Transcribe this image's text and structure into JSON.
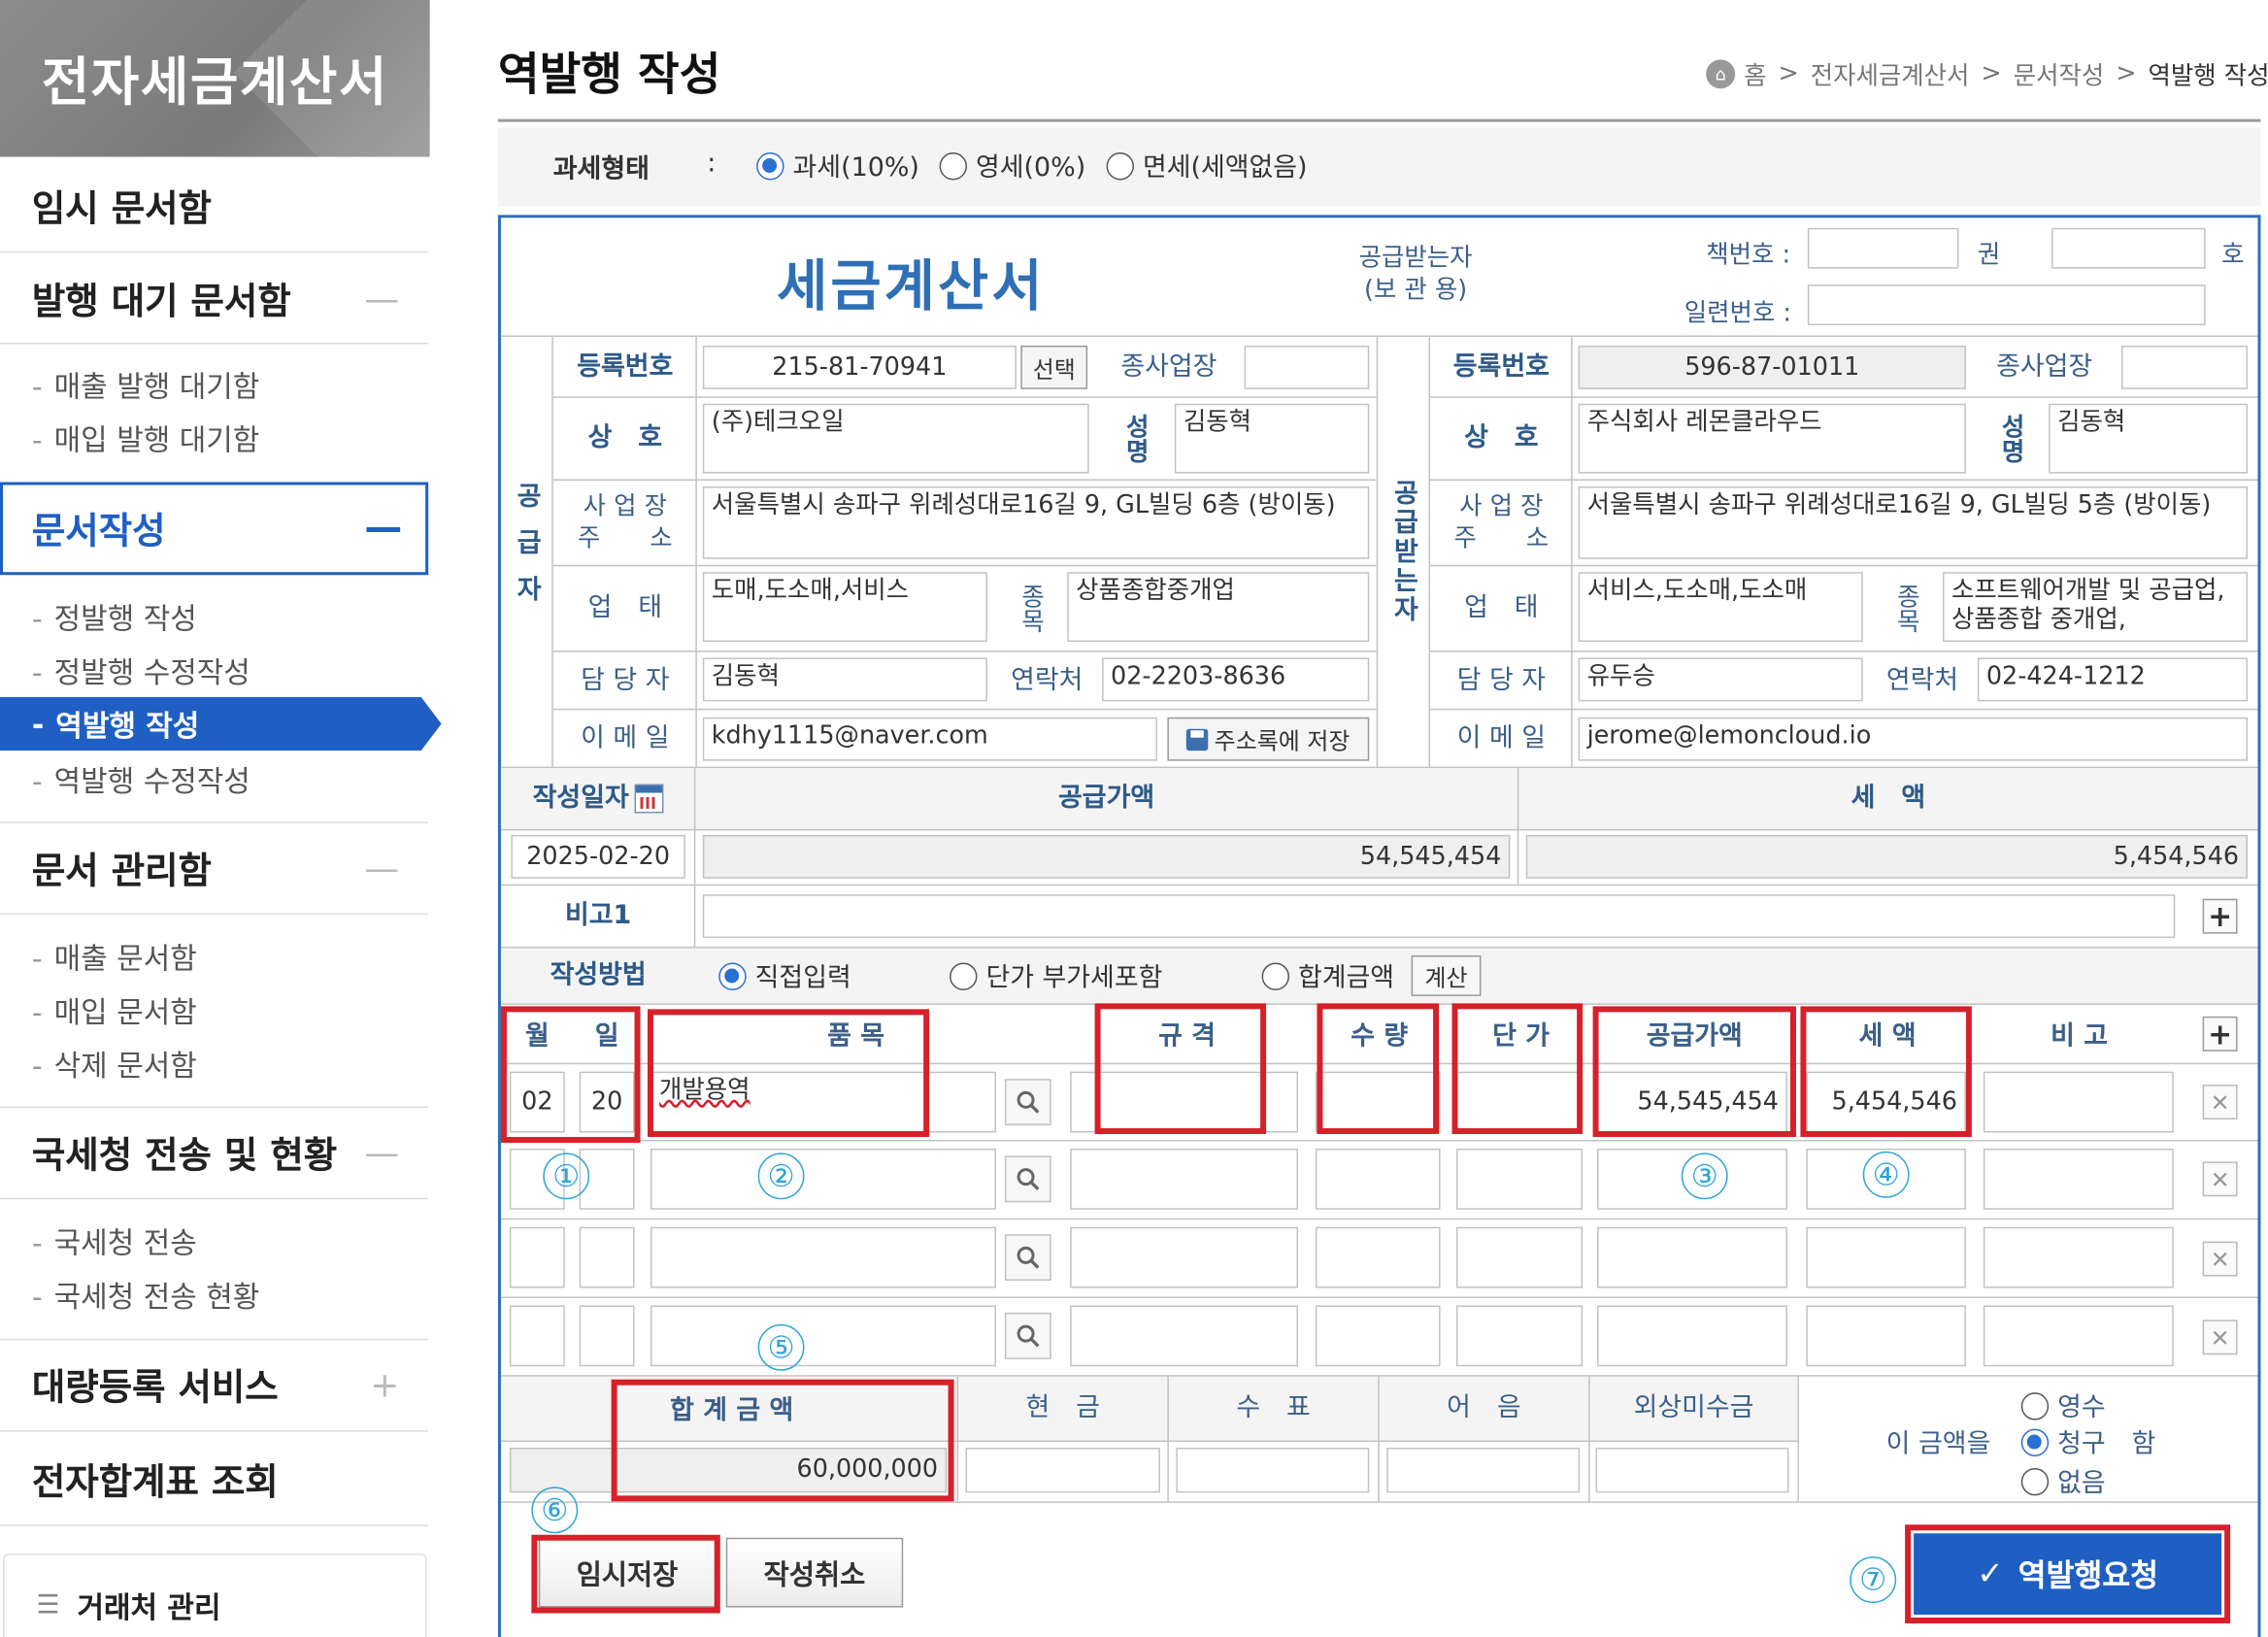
{
  "sidebar": {
    "title": "전자세금계산서",
    "sections": [
      {
        "label": "임시 문서함"
      },
      {
        "label": "발행 대기 문서함",
        "toggle": "—",
        "items": [
          "매출 발행 대기함",
          "매입 발행 대기함"
        ]
      },
      {
        "label": "문서작성",
        "toggle": "—",
        "items": [
          "정발행 작성",
          "정발행 수정작성",
          "역발행 작성",
          "역발행 수정작성"
        ],
        "active_item": "역발행 작성"
      },
      {
        "label": "문서 관리함",
        "toggle": "—",
        "items": [
          "매출 문서함",
          "매입 문서함",
          "삭제 문서함"
        ]
      },
      {
        "label": "국세청 전송 및 현황",
        "toggle": "—",
        "items": [
          "국세청 전송",
          "국세청 전송 현황"
        ]
      },
      {
        "label": "대량등록 서비스",
        "toggle": "+"
      },
      {
        "label": "전자합계표 조회"
      }
    ],
    "bottom_label": "거래처 관리"
  },
  "page": {
    "title": "역발행 작성",
    "breadcrumb": [
      "홈",
      "전자세금계산서",
      "문서작성",
      "역발행 작성"
    ]
  },
  "tax_type": {
    "label": "과세형태",
    "colon": ":",
    "options": [
      "과세(10%)",
      "영세(0%)",
      "면세(세액없음)"
    ],
    "selected": "과세(10%)"
  },
  "invoice": {
    "title": "세금계산서",
    "recipient_note": "공급받는자",
    "recipient_note2": "(보 관 용)",
    "book_no_label": "책번호 :",
    "book_kwon": "권",
    "book_ho": "호",
    "serial_label": "일련번호 :"
  },
  "supplier": {
    "side_label": "공급자",
    "reg_no_label": "등록번호",
    "reg_no": "215-81-70941",
    "select_button": "선택",
    "branch_label": "종사업장",
    "name_label": "상　호",
    "name": "(주)테크오일",
    "rep_label": "성명",
    "rep": "김동혁",
    "addr_label": "사 업 장\n주　　소",
    "addr": "서울특별시 송파구 위례성대로16길 9, GL빌딩 6층 (방이동)",
    "biz_type_label": "업　태",
    "biz_type": "도매,도소매,서비스",
    "biz_item_label": "종목",
    "biz_item": "상품종합중개업",
    "contact_label": "담 당 자",
    "contact": "김동혁",
    "phone_label": "연락처",
    "phone": "02-2203-8636",
    "email_label": "이 메 일",
    "email": "kdhy1115@naver.com",
    "save_addr_button": "주소록에 저장"
  },
  "receiver": {
    "side_label": "공급받는자",
    "reg_no_label": "등록번호",
    "reg_no": "596-87-01011",
    "branch_label": "종사업장",
    "name_label": "상　호",
    "name": "주식회사 레몬클라우드",
    "rep_label": "성명",
    "rep": "김동혁",
    "addr_label": "사 업 장\n주　　소",
    "addr": "서울특별시 송파구 위례성대로16길 9, GL빌딩 5층 (방이동)",
    "biz_type_label": "업　태",
    "biz_type": "서비스,도소매,도소매",
    "biz_item_label": "종목",
    "biz_item": "소프트웨어개발 및 공급업,상품종합 중개업,",
    "contact_label": "담 당 자",
    "contact": "유두승",
    "phone_label": "연락처",
    "phone": "02-424-1212",
    "email_label": "이 메 일",
    "email": "jerome@lemoncloud.io"
  },
  "summary": {
    "date_label": "작성일자",
    "date": "2025-02-20",
    "supply_label": "공급가액",
    "supply": "54,545,454",
    "tax_label": "세　액",
    "tax": "5,454,546",
    "note1_label": "비고1",
    "method_label": "작성방법",
    "method_options": [
      "직접입력",
      "단가 부가세포함",
      "합계금액"
    ],
    "method_selected": "직접입력",
    "calc_button": "계산"
  },
  "items": {
    "headers": [
      "월",
      "일",
      "품 목",
      "규 격",
      "수 량",
      "단 가",
      "공급가액",
      "세 액",
      "비 고"
    ],
    "rows": [
      {
        "month": "02",
        "day": "20",
        "item": "개발용역",
        "spec": "",
        "qty": "",
        "price": "",
        "supply": "54,545,454",
        "tax": "5,454,546",
        "note": ""
      },
      {
        "month": "",
        "day": "",
        "item": "",
        "spec": "",
        "qty": "",
        "price": "",
        "supply": "",
        "tax": "",
        "note": ""
      },
      {
        "month": "",
        "day": "",
        "item": "",
        "spec": "",
        "qty": "",
        "price": "",
        "supply": "",
        "tax": "",
        "note": ""
      },
      {
        "month": "",
        "day": "",
        "item": "",
        "spec": "",
        "qty": "",
        "price": "",
        "supply": "",
        "tax": "",
        "note": ""
      }
    ]
  },
  "totals": {
    "total_label": "합 계 금 액",
    "total": "60,000,000",
    "cash_label": "현　금",
    "check_label": "수　표",
    "note_label": "어　음",
    "credit_label": "외상미수금",
    "amount_prefix": "이 금액을",
    "receipt_options": [
      "영수",
      "청구　함",
      "없음"
    ],
    "receipt_selected": "청구　함"
  },
  "buttons": {
    "temp_save": "임시저장",
    "cancel": "작성취소",
    "request": "역발행요청"
  },
  "annotations": [
    "①",
    "②",
    "③",
    "④",
    "⑤",
    "⑥",
    "⑦"
  ],
  "colors": {
    "accent_blue": "#1f5fc4",
    "active_nav": "#1f5fc4",
    "highlight_red": "#d6202a",
    "label_blue": "#3b5f88",
    "annotation_cyan": "#2ea4d8"
  }
}
